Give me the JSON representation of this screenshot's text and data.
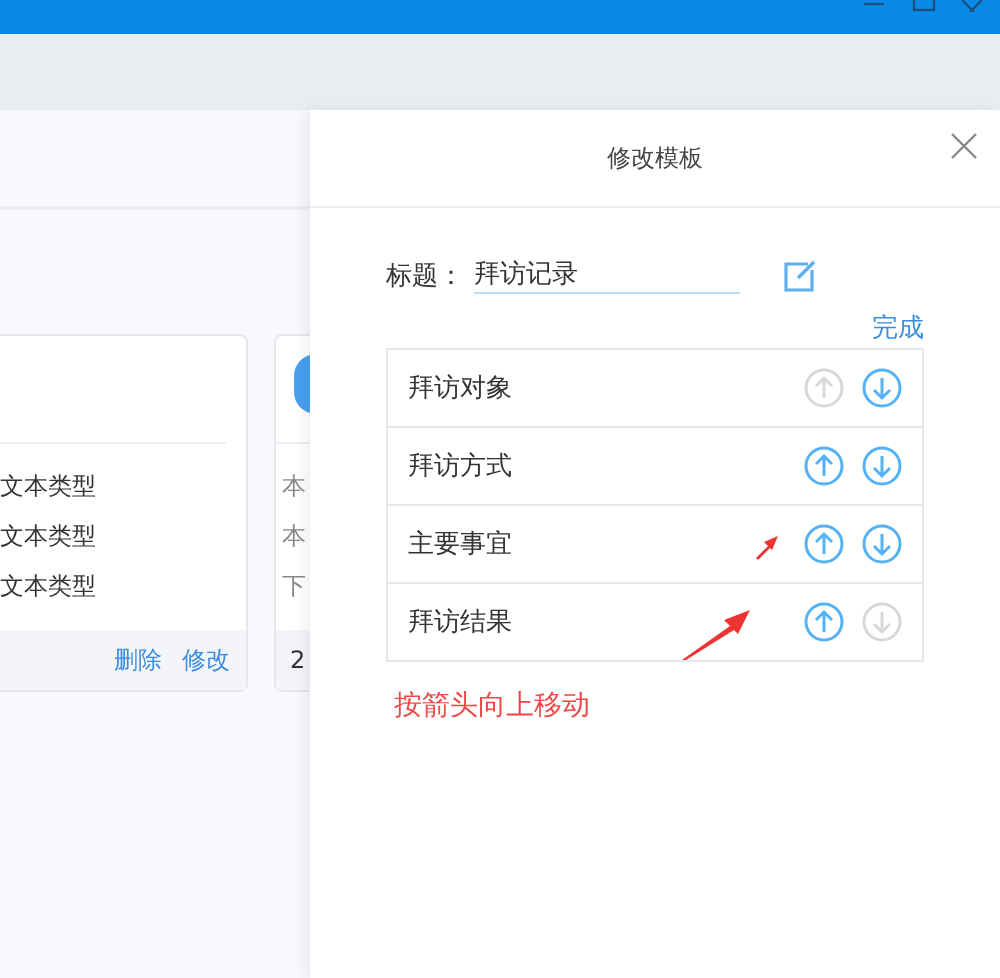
{
  "background_cards": [
    {
      "fields": [
        "文本类型",
        "文本类型",
        "文本类型"
      ],
      "actions": [
        "删除",
        "修改"
      ]
    },
    {
      "fields": [
        "本",
        "本",
        "下"
      ],
      "footer": "2"
    }
  ],
  "panel": {
    "title": "修改模板",
    "title_label": "标题：",
    "title_value": "拜访记录",
    "done_link": "完成",
    "fields": [
      {
        "label": "拜访对象",
        "up_disabled": true,
        "down_disabled": false
      },
      {
        "label": "拜访方式",
        "up_disabled": false,
        "down_disabled": false
      },
      {
        "label": "主要事宜",
        "up_disabled": false,
        "down_disabled": false
      },
      {
        "label": "拜访结果",
        "up_disabled": false,
        "down_disabled": true
      }
    ],
    "annotation": "按箭头向上移动"
  }
}
